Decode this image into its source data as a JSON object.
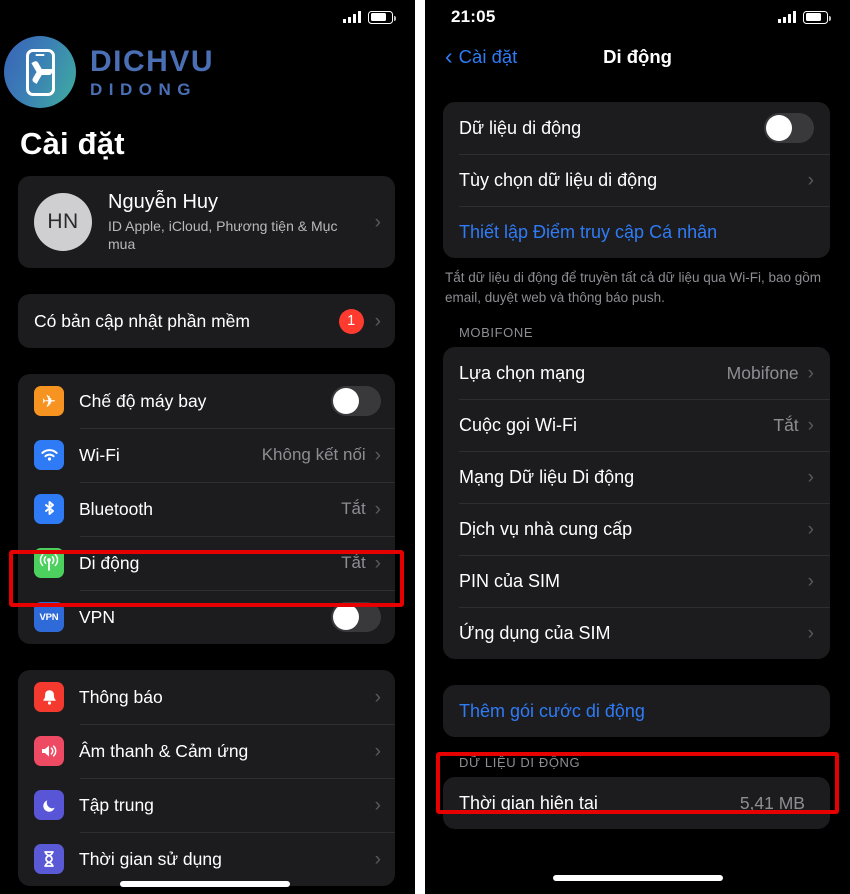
{
  "left": {
    "status": {
      "time": "",
      "signal_icon": "signal-bars-icon",
      "battery_icon": "battery-icon"
    },
    "brand": {
      "line1": "DICHVU",
      "line2": "DIDONG",
      "logo_icon": "dichvu-didong-logo"
    },
    "page_title": "Cài đặt",
    "profile": {
      "initials": "HN",
      "name": "Nguyễn Huy",
      "subtitle": "ID Apple, iCloud, Phương tiện & Mục mua",
      "chevron": "›"
    },
    "update": {
      "label": "Có bản cập nhật phần mềm",
      "badge": "1",
      "chevron": "›"
    },
    "group_connectivity": [
      {
        "label": "Chế độ máy bay",
        "icon": "airplane-icon",
        "icon_class": "ic-plane",
        "glyph": "✈",
        "control": "toggle",
        "toggle_on": false
      },
      {
        "label": "Wi-Fi",
        "icon": "wifi-icon",
        "icon_class": "ic-wifi",
        "glyph": "≋",
        "control": "value",
        "value": "Không kết nối",
        "chevron": "›"
      },
      {
        "label": "Bluetooth",
        "icon": "bluetooth-icon",
        "icon_class": "ic-bt",
        "glyph": "✣",
        "control": "value",
        "value": "Tắt",
        "chevron": "›"
      },
      {
        "label": "Di động",
        "icon": "cellular-icon",
        "icon_class": "ic-cell",
        "glyph": "((p))",
        "control": "value",
        "value": "Tắt",
        "chevron": "›",
        "highlighted": true
      },
      {
        "label": "VPN",
        "icon": "vpn-icon",
        "icon_class": "ic-vpn",
        "glyph": "VPN",
        "control": "toggle",
        "toggle_on": false
      }
    ],
    "group_system": [
      {
        "label": "Thông báo",
        "icon": "bell-icon",
        "icon_class": "ic-bell",
        "glyph": "🔔",
        "chevron": "›"
      },
      {
        "label": "Âm thanh & Cảm ứng",
        "icon": "sound-icon",
        "icon_class": "ic-sound",
        "glyph": "🔊",
        "chevron": "›"
      },
      {
        "label": "Tập trung",
        "icon": "moon-icon",
        "icon_class": "ic-focus",
        "glyph": "☾",
        "chevron": "›"
      },
      {
        "label": "Thời gian sử dụng",
        "icon": "hourglass-icon",
        "icon_class": "ic-time",
        "glyph": "⧗",
        "chevron": "›"
      }
    ]
  },
  "right": {
    "status": {
      "time": "21:05",
      "signal_icon": "signal-bars-icon",
      "battery_icon": "battery-icon"
    },
    "nav": {
      "back_label": "Cài đặt",
      "back_chevron": "‹",
      "title": "Di động"
    },
    "group_data": [
      {
        "label": "Dữ liệu di động",
        "control": "toggle",
        "toggle_on": false
      },
      {
        "label": "Tùy chọn dữ liệu di động",
        "control": "chevron",
        "chevron": "›"
      },
      {
        "label": "Thiết lập Điểm truy cập Cá nhân",
        "control": "none",
        "blue": true
      }
    ],
    "footnote": "Tắt dữ liệu di động để truyền tất cả dữ liệu qua Wi-Fi, bao gồm email, duyệt web và thông báo push.",
    "carrier_header": "MOBIFONE",
    "group_carrier": [
      {
        "label": "Lựa chọn mạng",
        "value": "Mobifone",
        "chevron": "›"
      },
      {
        "label": "Cuộc gọi Wi-Fi",
        "value": "Tắt",
        "chevron": "›"
      },
      {
        "label": "Mạng Dữ liệu Di động",
        "value": "",
        "chevron": "›"
      },
      {
        "label": "Dịch vụ nhà cung cấp",
        "value": "",
        "chevron": "›"
      },
      {
        "label": "PIN của SIM",
        "value": "",
        "chevron": "›"
      },
      {
        "label": "Ứng dụng của SIM",
        "value": "",
        "chevron": "›"
      }
    ],
    "add_plan": {
      "label": "Thêm gói cước di động",
      "highlighted": true
    },
    "usage_header": "DỮ LIỆU DI ĐỘNG",
    "usage_row": {
      "label": "Thời gian hiện tại",
      "value": "5,41 MB"
    }
  },
  "colors": {
    "accent_blue": "#2f7bf6",
    "brand_blue": "#4a6fb5",
    "highlight_red": "#e60000",
    "badge_red": "#ff3b30",
    "card_bg": "#1c1c1e",
    "page_bg": "#000000"
  }
}
